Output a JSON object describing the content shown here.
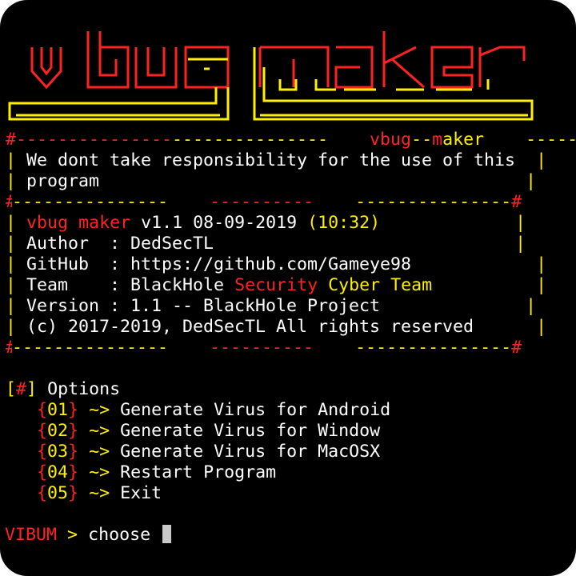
{
  "colors": {
    "background": "#000000",
    "yellow": "#ffef00",
    "red": "#ff2222",
    "white": "#ffffff",
    "cursor": "#c9c9c9"
  },
  "logo": {
    "text": "vbug maker"
  },
  "banner": {
    "border_dash_a": "#---------------",
    "border_dash_b": "----------------#",
    "title_vbug": "vbug",
    "title_sep": "--",
    "title_m": "m",
    "title_aker": "aker",
    "disclaimer_1": "We dont take responsibility for the use of this",
    "disclaimer_2": "program",
    "sep_left": "#---------------",
    "sep_mid": "----------",
    "sep_right": "---------------#",
    "app_vbug": "vbug",
    "app_maker": "maker",
    "app_version": "v1.1 08-09-2019",
    "app_time": "(10:32)",
    "author": "Author  : DedSecTL",
    "github": "GitHub  : https://github.com/Gameye98",
    "team_prefix": "Team    : BlackHole",
    "team_security": "Security",
    "team_suffix": "Cyber Team",
    "version": "Version : 1.1 -- BlackHole Project",
    "copyright": "(c) 2017-2019, DedSecTL All rights reserved",
    "pipe": "|"
  },
  "menu": {
    "header_bracket_open": "[",
    "header_hash": "#",
    "header_bracket_close": "]",
    "header_label": "Options",
    "arrow": "~>",
    "items": [
      {
        "num": "01",
        "label": "Generate Virus for Android"
      },
      {
        "num": "02",
        "label": "Generate Virus for Window"
      },
      {
        "num": "03",
        "label": "Generate Virus for MacOSX"
      },
      {
        "num": "04",
        "label": "Restart Program"
      },
      {
        "num": "05",
        "label": "Exit"
      }
    ]
  },
  "prompt": {
    "name": "VIBUM",
    "symbol": ">",
    "input": "choose"
  }
}
